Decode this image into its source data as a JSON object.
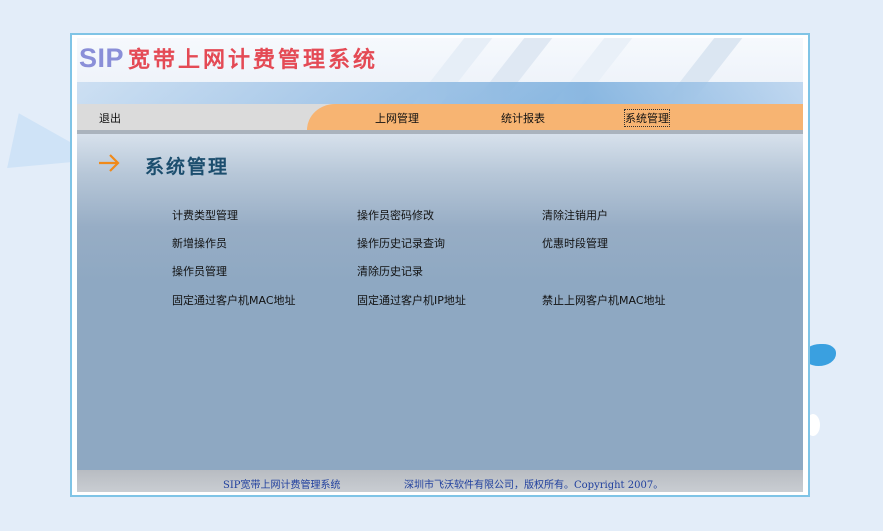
{
  "header": {
    "logo_sip": "SIP",
    "logo_title": "宽带上网计费管理系统"
  },
  "nav": {
    "logout": "退出",
    "items": [
      "上网管理",
      "统计报表",
      "系统管理"
    ],
    "selected": "系统管理"
  },
  "section": {
    "title": "系统管理"
  },
  "menu": {
    "col1": [
      "计费类型管理",
      "新增操作员",
      "操作员管理",
      "固定通过客户机MAC地址"
    ],
    "col2": [
      "操作员密码修改",
      "操作历史记录查询",
      "清除历史记录",
      "固定通过客户机IP地址"
    ],
    "col3": [
      "清除注销用户",
      "优惠时段管理",
      "禁止上网客户机MAC地址"
    ]
  },
  "footer": {
    "product": "SIP宽带上网计费管理系统",
    "copyright": "深圳市飞沃软件有限公司，版权所有。Copyright 2007。"
  },
  "colors": {
    "accent_orange": "#f7b472",
    "content_bg": "#8ea8c2",
    "frame_border": "#7fc4e6",
    "logo_red": "#e44a55",
    "logo_purple": "#8a8fd8",
    "footer_text": "#1f3f9e"
  },
  "icons": {
    "section_arrow": "arrow-right-icon"
  }
}
